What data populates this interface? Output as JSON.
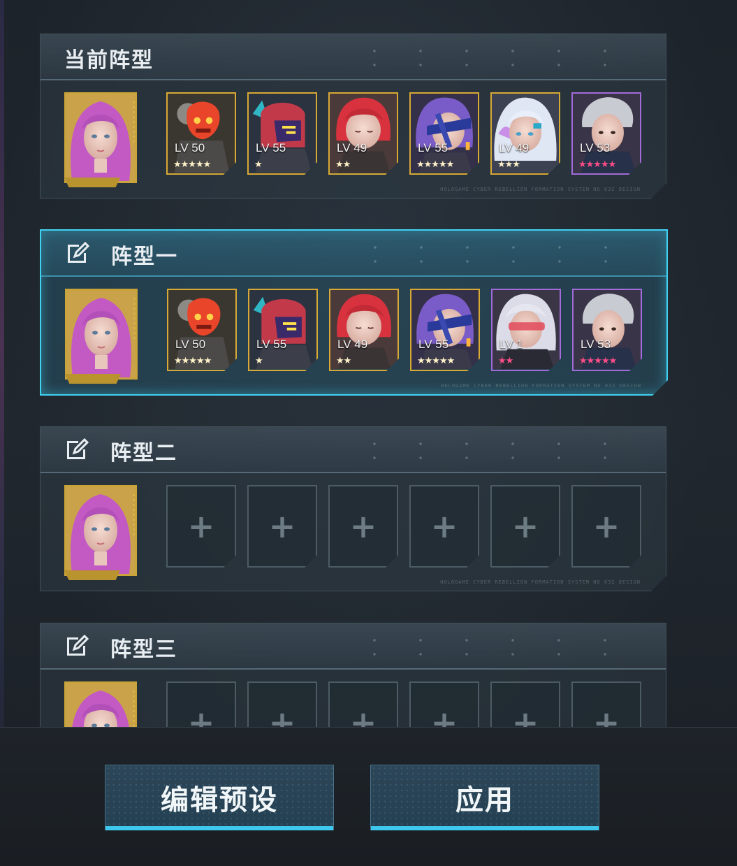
{
  "current": {
    "title": "当前阵型",
    "heroes": [
      {
        "lv": "LV 50",
        "stars": "★★★★★",
        "rarity": "gold",
        "icon": "red-mask-hero"
      },
      {
        "lv": "LV 55",
        "stars": "★",
        "rarity": "gold",
        "icon": "mech-helmet-hero"
      },
      {
        "lv": "LV 49",
        "stars": "★★",
        "rarity": "gold",
        "icon": "red-hair-hero"
      },
      {
        "lv": "LV 55",
        "stars": "★★★★★",
        "rarity": "gold",
        "icon": "visor-purple-hair-hero"
      },
      {
        "lv": "LV 49",
        "stars": "★★★",
        "rarity": "gold",
        "icon": "white-hair-girl-hero"
      },
      {
        "lv": "LV 53",
        "stars": "★★★★★",
        "rarity": "purple",
        "icon": "silver-hair-man-hero"
      }
    ],
    "micro": "HOLOGAME   CYBER REBELLION   FORMATION SYSTEM   NO 032 DESIGN"
  },
  "formations": [
    {
      "title": "阵型一",
      "selected": true,
      "heroes": [
        {
          "lv": "LV 50",
          "stars": "★★★★★",
          "rarity": "gold",
          "icon": "red-mask-hero"
        },
        {
          "lv": "LV 55",
          "stars": "★",
          "rarity": "gold",
          "icon": "mech-helmet-hero"
        },
        {
          "lv": "LV 49",
          "stars": "★★",
          "rarity": "gold",
          "icon": "red-hair-hero"
        },
        {
          "lv": "LV 55",
          "stars": "★★★★★",
          "rarity": "gold",
          "icon": "visor-purple-hair-hero"
        },
        {
          "lv": "LV 1",
          "stars": "★★",
          "rarity": "purple",
          "icon": "goggles-girl-hero"
        },
        {
          "lv": "LV 53",
          "stars": "★★★★★",
          "rarity": "purple",
          "icon": "silver-hair-man-hero"
        }
      ]
    },
    {
      "title": "阵型二",
      "selected": false,
      "empty_symbol": "+"
    },
    {
      "title": "阵型三",
      "selected": false,
      "empty_symbol": "+"
    }
  ],
  "buttons": {
    "edit_preset": "编辑预设",
    "apply": "应用"
  },
  "colors": {
    "accent": "#3fd2f2",
    "gold_frame": "#d8a935",
    "purple_frame": "#a16bd8",
    "star_pink": "#ff4d88"
  }
}
